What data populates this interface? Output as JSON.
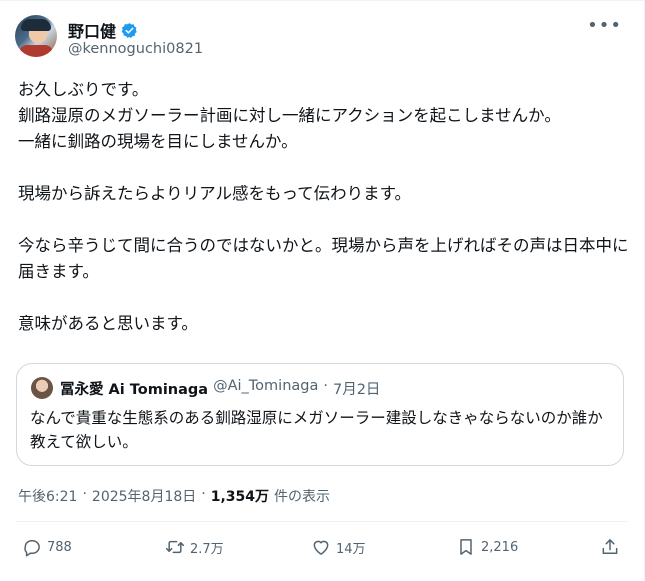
{
  "author": {
    "display_name": "野口健",
    "handle": "@kennoguchi0821"
  },
  "tweet": {
    "text": "お久しぶりです。\n釧路湿原のメガソーラー計画に対し一緒にアクションを起こしませんか。\n一緒に釧路の現場を目にしませんか。\n\n現場から訴えたらよりリアル感をもって伝わります。\n\n今なら辛うじて間に合うのではないかと。現場から声を上げればその声は日本中に届きます。\n\n意味があると思います。"
  },
  "quote": {
    "display_name": "冨永愛 Ai Tominaga",
    "handle": "@Ai_Tominaga",
    "separator": "·",
    "date": "7月2日",
    "text": "なんで貴重な生態系のある釧路湿原にメガソーラー建設しなきゃならないのか誰か教えて欲しい。"
  },
  "meta": {
    "time": "午後6:21",
    "sep1": "·",
    "date": "2025年8月18日",
    "sep2": "·",
    "views": "1,354万",
    "views_label": "件の表示"
  },
  "actions": {
    "reply_count": "788",
    "retweet_count": "2.7万",
    "like_count": "14万",
    "bookmark_count": "2,216"
  },
  "icons": {
    "verified": "verified-badge-icon",
    "more": "more-icon",
    "reply": "reply-icon",
    "retweet": "retweet-icon",
    "like": "heart-icon",
    "bookmark": "bookmark-icon",
    "share": "share-icon"
  },
  "colors": {
    "verified": "#1d9bf0",
    "secondary_text": "#536471",
    "border": "#cfd9de"
  }
}
